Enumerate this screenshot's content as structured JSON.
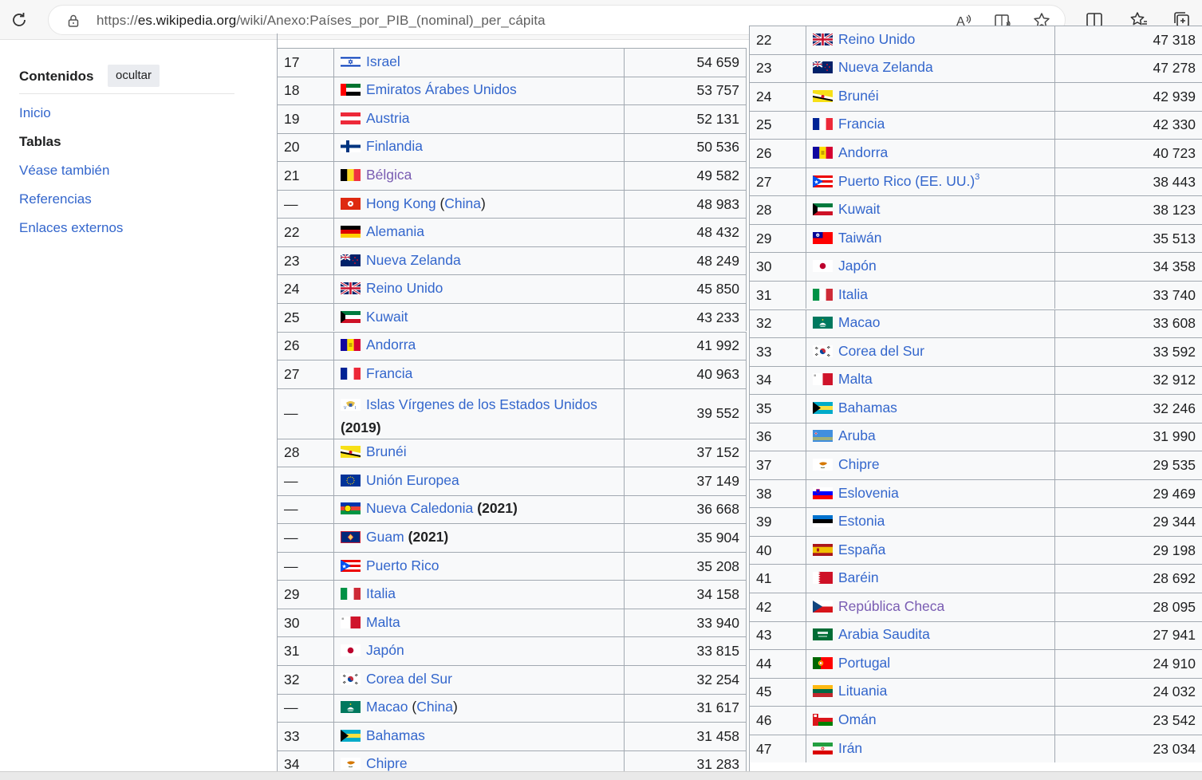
{
  "browser": {
    "url_prefix": "https://",
    "url_host": "es.wikipedia.org",
    "url_path": "/wiki/Anexo:Países_por_PIB_(nominal)_per_cápita"
  },
  "toc": {
    "title": "Contenidos",
    "hide_label": "ocultar",
    "items": [
      {
        "label": "Inicio",
        "active": false
      },
      {
        "label": "Tablas",
        "active": true
      },
      {
        "label": "Véase también",
        "active": false
      },
      {
        "label": "Referencias",
        "active": false
      },
      {
        "label": "Enlaces externos",
        "active": false
      }
    ]
  },
  "left_table": [
    {
      "rank": "17",
      "country": "Israel",
      "flag": "israel",
      "value": "54 659"
    },
    {
      "rank": "18",
      "country": "Emiratos Árabes Unidos",
      "flag": "uae",
      "value": "53 757"
    },
    {
      "rank": "19",
      "country": "Austria",
      "flag": "austria",
      "value": "52 131"
    },
    {
      "rank": "20",
      "country": "Finlandia",
      "flag": "finland",
      "value": "50 536"
    },
    {
      "rank": "21",
      "country": "Bélgica",
      "flag": "belgium",
      "value": "49 582",
      "visited": true
    },
    {
      "rank": "—",
      "country": "Hong Kong",
      "suffix_link": "China",
      "flag": "hongkong",
      "value": "48 983"
    },
    {
      "rank": "22",
      "country": "Alemania",
      "flag": "germany",
      "value": "48 432"
    },
    {
      "rank": "23",
      "country": "Nueva Zelanda",
      "flag": "nz",
      "value": "48 249"
    },
    {
      "rank": "24",
      "country": "Reino Unido",
      "flag": "uk",
      "value": "45 850"
    },
    {
      "rank": "25",
      "country": "Kuwait",
      "flag": "kuwait",
      "value": "43 233"
    },
    {
      "rank": "26",
      "country": "Andorra",
      "flag": "andorra",
      "value": "41 992"
    },
    {
      "rank": "27",
      "country": "Francia",
      "flag": "france",
      "value": "40 963"
    },
    {
      "rank": "—",
      "country": "Islas Vírgenes de los Estados Unidos",
      "bold_suffix": "(2019)",
      "flag": "usvi",
      "value": "39 552",
      "tall": true
    },
    {
      "rank": "28",
      "country": "Brunéi",
      "flag": "brunei",
      "value": "37 152"
    },
    {
      "rank": "—",
      "country": "Unión Europea",
      "flag": "eu",
      "value": "37 149"
    },
    {
      "rank": "—",
      "country": "Nueva Caledonia",
      "bold_suffix": "(2021)",
      "flag": "newcal",
      "value": "36 668"
    },
    {
      "rank": "—",
      "country": "Guam",
      "bold_suffix": "(2021)",
      "flag": "guam",
      "value": "35 904"
    },
    {
      "rank": "—",
      "country": "Puerto Rico",
      "flag": "pr",
      "value": "35 208"
    },
    {
      "rank": "29",
      "country": "Italia",
      "flag": "italy",
      "value": "34 158"
    },
    {
      "rank": "30",
      "country": "Malta",
      "flag": "malta",
      "value": "33 940"
    },
    {
      "rank": "31",
      "country": "Japón",
      "flag": "japan",
      "value": "33 815"
    },
    {
      "rank": "32",
      "country": "Corea del Sur",
      "flag": "korea",
      "value": "32 254"
    },
    {
      "rank": "—",
      "country": "Macao",
      "suffix_link": "China",
      "flag": "macao",
      "value": "31 617"
    },
    {
      "rank": "33",
      "country": "Bahamas",
      "flag": "bahamas",
      "value": "31 458"
    },
    {
      "rank": "34",
      "country": "Chipre",
      "flag": "cyprus",
      "value": "31 283"
    }
  ],
  "right_table": [
    {
      "rank": "22",
      "country": "Reino Unido",
      "flag": "uk",
      "value": "47 318"
    },
    {
      "rank": "23",
      "country": "Nueva Zelanda",
      "flag": "nz",
      "value": "47 278"
    },
    {
      "rank": "24",
      "country": "Brunéi",
      "flag": "brunei",
      "value": "42 939"
    },
    {
      "rank": "25",
      "country": "Francia",
      "flag": "france",
      "value": "42 330"
    },
    {
      "rank": "26",
      "country": "Andorra",
      "flag": "andorra",
      "value": "40 723"
    },
    {
      "rank": "27",
      "country": "Puerto Rico (EE. UU.)",
      "sup": "3",
      "flag": "pr",
      "value": "38 443"
    },
    {
      "rank": "28",
      "country": "Kuwait",
      "flag": "kuwait",
      "value": "38 123"
    },
    {
      "rank": "29",
      "country": "Taiwán",
      "flag": "taiwan",
      "value": "35 513"
    },
    {
      "rank": "30",
      "country": "Japón",
      "flag": "japan",
      "value": "34 358"
    },
    {
      "rank": "31",
      "country": "Italia",
      "flag": "italy",
      "value": "33 740"
    },
    {
      "rank": "32",
      "country": "Macao",
      "flag": "macao",
      "value": "33 608"
    },
    {
      "rank": "33",
      "country": "Corea del Sur",
      "flag": "korea",
      "value": "33 592"
    },
    {
      "rank": "34",
      "country": "Malta",
      "flag": "malta",
      "value": "32 912"
    },
    {
      "rank": "35",
      "country": "Bahamas",
      "flag": "bahamas",
      "value": "32 246"
    },
    {
      "rank": "36",
      "country": "Aruba",
      "flag": "aruba",
      "value": "31 990"
    },
    {
      "rank": "37",
      "country": "Chipre",
      "flag": "cyprus",
      "value": "29 535"
    },
    {
      "rank": "38",
      "country": "Eslovenia",
      "flag": "slovenia",
      "value": "29 469"
    },
    {
      "rank": "39",
      "country": "Estonia",
      "flag": "estonia",
      "value": "29 344"
    },
    {
      "rank": "40",
      "country": "España",
      "flag": "spain",
      "value": "29 198"
    },
    {
      "rank": "41",
      "country": "Baréin",
      "flag": "bahrain",
      "value": "28 692"
    },
    {
      "rank": "42",
      "country": "República Checa",
      "flag": "czech",
      "value": "28 095",
      "visited": true
    },
    {
      "rank": "43",
      "country": "Arabia Saudita",
      "flag": "saudi",
      "value": "27 941"
    },
    {
      "rank": "44",
      "country": "Portugal",
      "flag": "portugal",
      "value": "24 910"
    },
    {
      "rank": "45",
      "country": "Lituania",
      "flag": "lithuania",
      "value": "24 032"
    },
    {
      "rank": "46",
      "country": "Omán",
      "flag": "oman",
      "value": "23 542"
    },
    {
      "rank": "47",
      "country": "Irán",
      "flag": "iran",
      "value": "23 034"
    }
  ]
}
